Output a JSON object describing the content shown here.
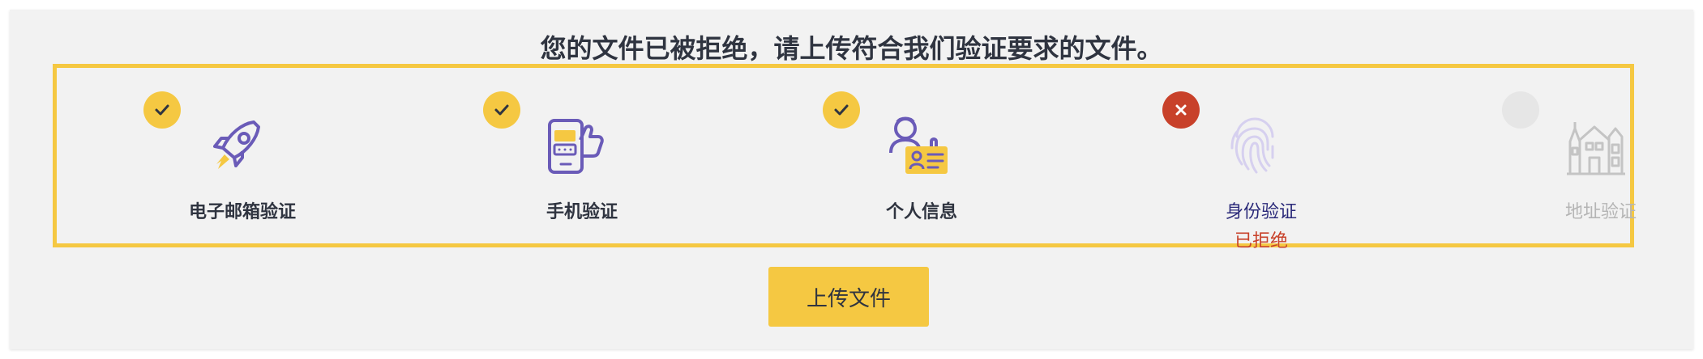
{
  "headline": "您的文件已被拒绝，请上传符合我们验证要求的文件。",
  "colors": {
    "accent": "#f5c842",
    "icon_purple": "#6a5bb8",
    "rejected": "#c8412a",
    "pending": "#e6e6e6",
    "muted": "#b5b5b5"
  },
  "steps": [
    {
      "label": "电子邮箱验证",
      "status": "done",
      "icon": "rocket-icon"
    },
    {
      "label": "手机验证",
      "status": "done",
      "icon": "phone-thumbs-up-icon"
    },
    {
      "label": "个人信息",
      "status": "done",
      "icon": "id-card-person-icon"
    },
    {
      "label": "身份验证",
      "status": "rejected",
      "status_text": "已拒绝",
      "icon": "fingerprint-icon"
    },
    {
      "label": "地址验证",
      "status": "pending",
      "icon": "buildings-icon"
    }
  ],
  "upload_button": "上传文件"
}
